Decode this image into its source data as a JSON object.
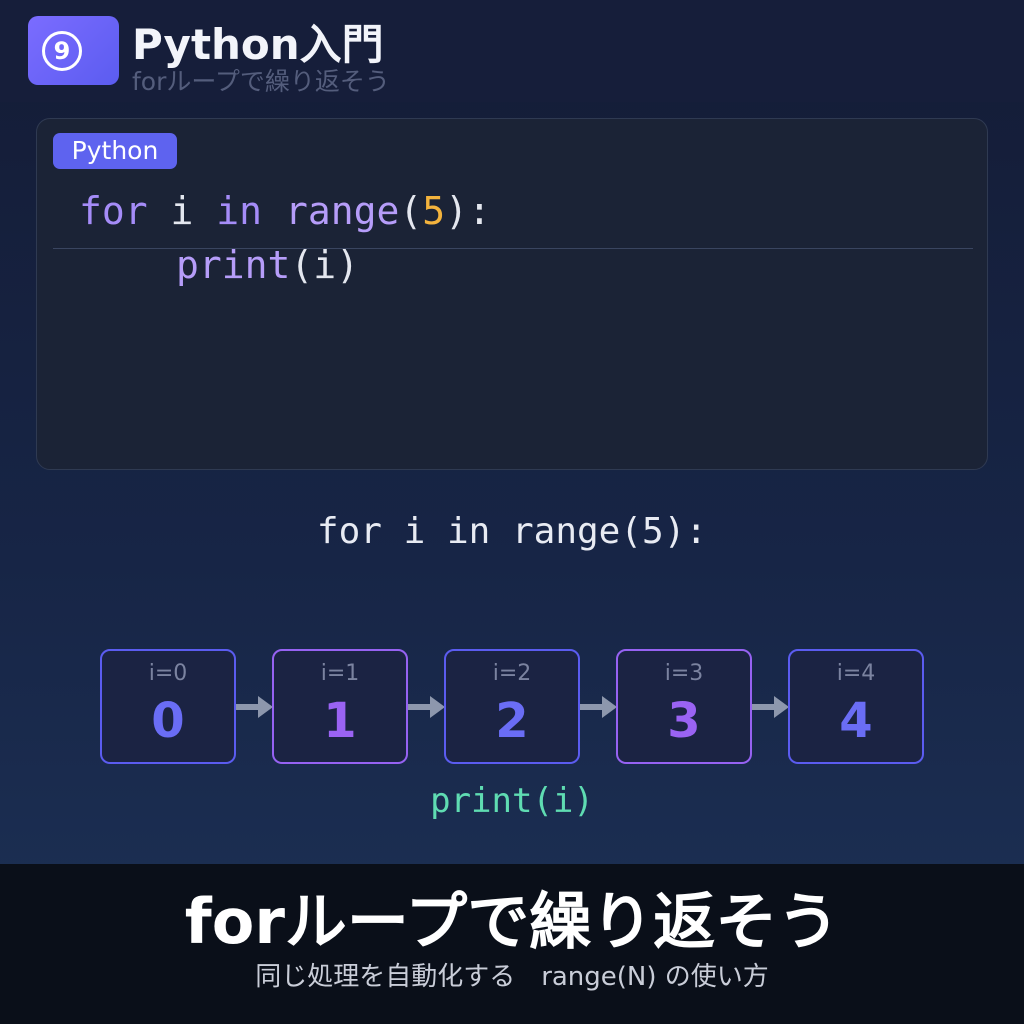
{
  "header": {
    "badge_number": "9",
    "title": "Python入門",
    "subtitle": "forループで繰り返そう"
  },
  "code_panel": {
    "language_tag": "Python",
    "line1": {
      "kw_for": "for",
      "var": " i ",
      "kw_in": "in",
      "space": " ",
      "fn_range": "range",
      "paren_open": "(",
      "arg": "5",
      "close": "):"
    },
    "line2": {
      "fn_print": "print",
      "args": "(i)"
    }
  },
  "diagram": {
    "loop_heading": "for i in range(5):",
    "iterations": [
      {
        "label": "i=0",
        "value": "0"
      },
      {
        "label": "i=1",
        "value": "1"
      },
      {
        "label": "i=2",
        "value": "2"
      },
      {
        "label": "i=3",
        "value": "3"
      },
      {
        "label": "i=4",
        "value": "4"
      }
    ],
    "print_label": "print(i)"
  },
  "footer": {
    "title": "forループで繰り返そう",
    "subtitle": "同じ処理を自動化する　range(N) の使い方"
  },
  "colors": {
    "accent": "#5e63ef",
    "accent_alt": "#9662f2",
    "number": "#f3b33d",
    "print": "#5fdcb2"
  }
}
